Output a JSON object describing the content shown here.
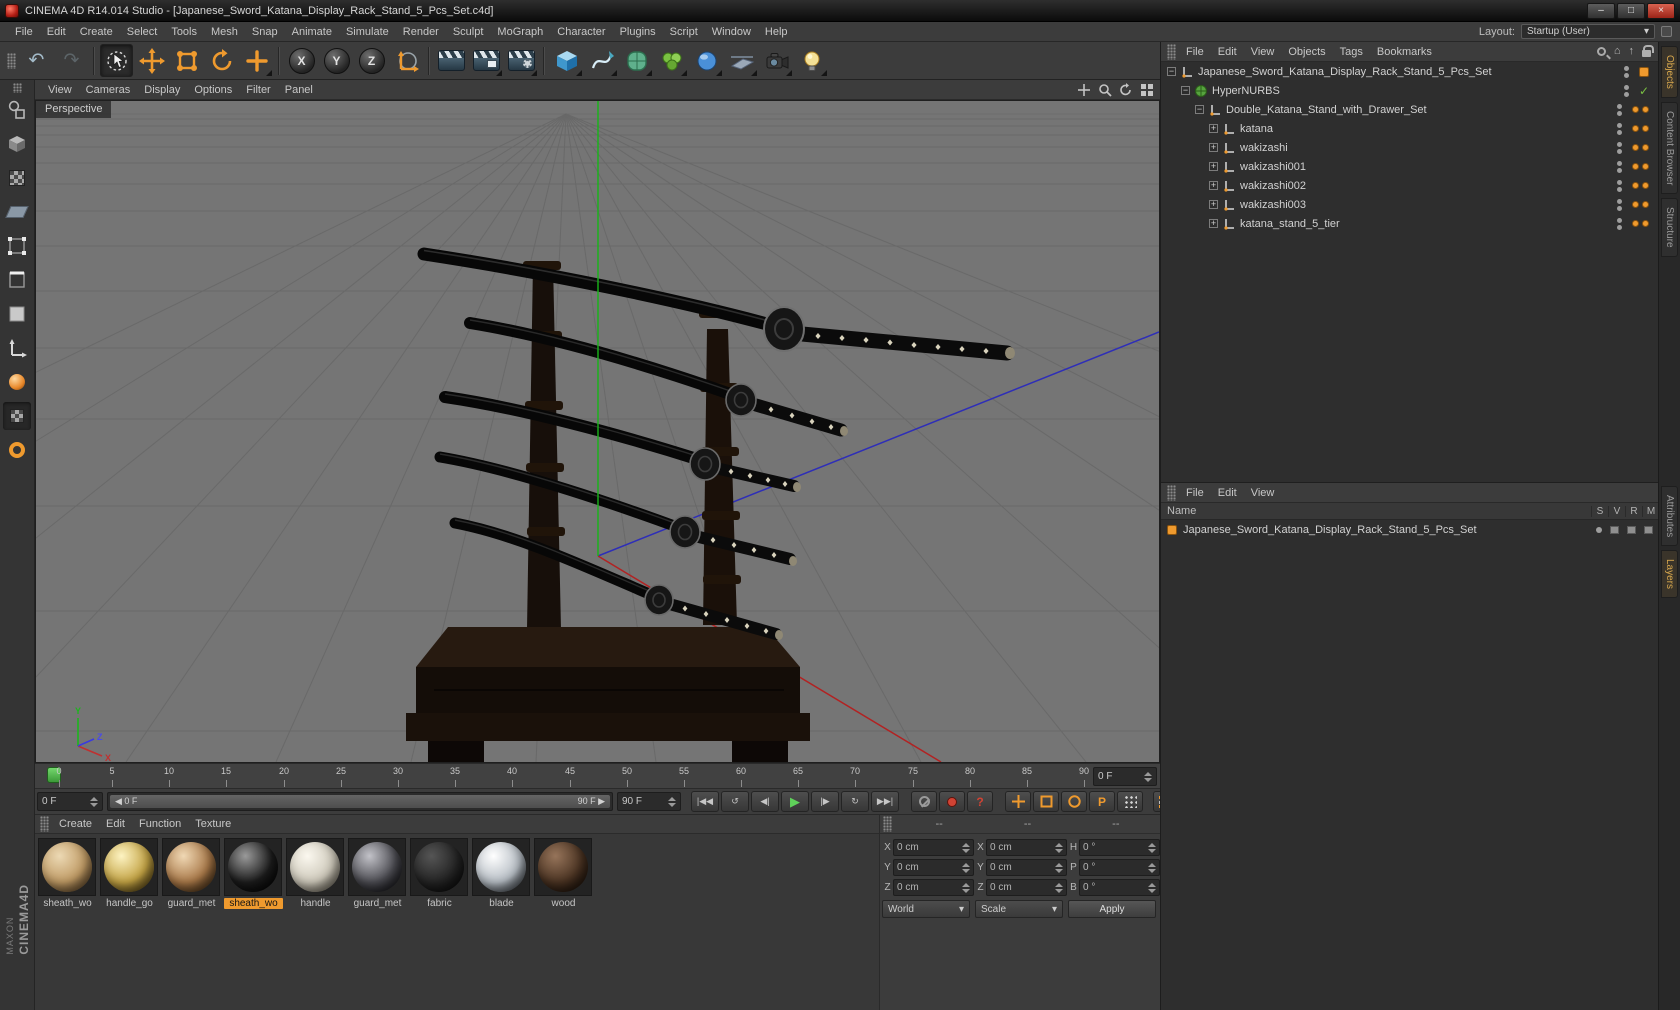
{
  "window": {
    "title": "CINEMA 4D R14.014 Studio - [Japanese_Sword_Katana_Display_Rack_Stand_5_Pcs_Set.c4d]"
  },
  "glyphs": {
    "minimize": "–",
    "maximize": "□",
    "close": "×",
    "undo": "↶",
    "redo": "↷",
    "chevron": "▾",
    "check": "✓",
    "home": "⌂",
    "up_arrow": "↑",
    "goto_start": "|◀◀",
    "play_back": "↺",
    "prev_frame": "◀|",
    "play": "▶",
    "next_frame": "|▶",
    "loop": "↻",
    "goto_end": "▶▶|",
    "question": "?",
    "param_p": "P"
  },
  "menubar": {
    "items": [
      "File",
      "Edit",
      "Create",
      "Select",
      "Tools",
      "Mesh",
      "Snap",
      "Animate",
      "Simulate",
      "Render",
      "Sculpt",
      "MoGraph",
      "Character",
      "Plugins",
      "Script",
      "Window",
      "Help"
    ],
    "layout_label": "Layout:",
    "layout_value": "Startup (User)"
  },
  "toolbar": {
    "axis_x": "X",
    "axis_y": "Y",
    "axis_z": "Z"
  },
  "viewport": {
    "menu": [
      "View",
      "Cameras",
      "Display",
      "Options",
      "Filter",
      "Panel"
    ],
    "view_label": "Perspective",
    "axis": {
      "x": "X",
      "y": "Y",
      "z": "Z"
    }
  },
  "object_manager": {
    "menu": [
      "File",
      "Edit",
      "View",
      "Objects",
      "Tags",
      "Bookmarks"
    ],
    "tree": [
      {
        "label": "Japanese_Sword_Katana_Display_Rack_Stand_5_Pcs_Set",
        "exp": "−"
      },
      {
        "label": "HyperNURBS",
        "exp": "−"
      },
      {
        "label": "Double_Katana_Stand_with_Drawer_Set",
        "exp": "−"
      },
      {
        "label": "katana",
        "exp": "+"
      },
      {
        "label": "wakizashi",
        "exp": "+"
      },
      {
        "label": "wakizashi001",
        "exp": "+"
      },
      {
        "label": "wakizashi002",
        "exp": "+"
      },
      {
        "label": "wakizashi003",
        "exp": "+"
      },
      {
        "label": "katana_stand_5_tier",
        "exp": "+"
      }
    ]
  },
  "layer_manager": {
    "menu": [
      "File",
      "Edit",
      "View"
    ],
    "name_header": "Name",
    "columns": [
      "S",
      "V",
      "R",
      "M"
    ],
    "row_label": "Japanese_Sword_Katana_Display_Rack_Stand_5_Pcs_Set"
  },
  "right_tabs": {
    "top": [
      "Objects",
      "Content Browser",
      "Structure"
    ],
    "bottom": [
      "Attributes",
      "Layers"
    ]
  },
  "timeline": {
    "ticks": [
      "0",
      "5",
      "10",
      "15",
      "20",
      "25",
      "30",
      "35",
      "40",
      "45",
      "50",
      "55",
      "60",
      "65",
      "70",
      "75",
      "80",
      "85",
      "90"
    ],
    "frame_field": "0 F"
  },
  "transport": {
    "current": "0 F",
    "range_start": "◀ 0 F",
    "range_end": "90 F ▶",
    "end": "90 F"
  },
  "materials": {
    "menu": [
      "Create",
      "Edit",
      "Function",
      "Texture"
    ],
    "items": [
      {
        "name": "sheath_wo",
        "light": "#ecd9b4",
        "base": "#bf9a64",
        "dark": "#5e4426",
        "selected": false
      },
      {
        "name": "handle_go",
        "light": "#fdf3c2",
        "base": "#c3a344",
        "dark": "#4e3c10",
        "selected": false
      },
      {
        "name": "guard_met",
        "light": "#f0d8b4",
        "base": "#a87848",
        "dark": "#402a12",
        "selected": false
      },
      {
        "name": "sheath_wo",
        "light": "#9a9a9a",
        "base": "#1c1c1c",
        "dark": "#000000",
        "selected": true
      },
      {
        "name": "handle",
        "light": "#fbf8ef",
        "base": "#cdc8ba",
        "dark": "#6a6456",
        "selected": false
      },
      {
        "name": "guard_met",
        "light": "#c2c2c8",
        "base": "#4c4c52",
        "dark": "#101014",
        "selected": false
      },
      {
        "name": "fabric",
        "light": "#555555",
        "base": "#242424",
        "dark": "#080808",
        "selected": false
      },
      {
        "name": "blade",
        "light": "#ffffff",
        "base": "#b6bdc4",
        "dark": "#343a40",
        "selected": false
      },
      {
        "name": "wood",
        "light": "#96745a",
        "base": "#4a3322",
        "dark": "#190f08",
        "selected": false
      }
    ]
  },
  "coordinates": {
    "headers": [
      "--",
      "--",
      "--"
    ],
    "position": [
      {
        "label": "X",
        "value": "0 cm"
      },
      {
        "label": "Y",
        "value": "0 cm"
      },
      {
        "label": "Z",
        "value": "0 cm"
      }
    ],
    "size": [
      {
        "label": "X",
        "value": "0 cm"
      },
      {
        "label": "Y",
        "value": "0 cm"
      },
      {
        "label": "Z",
        "value": "0 cm"
      }
    ],
    "rotation": [
      {
        "label": "H",
        "value": "0 °"
      },
      {
        "label": "P",
        "value": "0 °"
      },
      {
        "label": "B",
        "value": "0 °"
      }
    ],
    "space": "World",
    "mode": "Scale",
    "apply": "Apply"
  },
  "branding": {
    "maxon": "MAXON",
    "product": "CINEMA4D"
  },
  "colors": {
    "accent_orange": "#ef9a2e",
    "marker_green": "#58c554",
    "axis_green": "#17b517",
    "axis_red": "#b22222",
    "axis_blue": "#2e2eb8",
    "viewport_gray": "#757575"
  }
}
